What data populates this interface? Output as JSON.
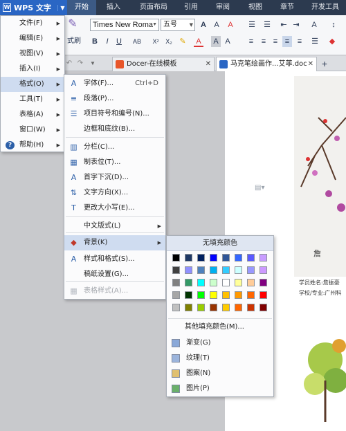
{
  "app": {
    "name": "WPS 文字"
  },
  "ribbon_tabs": [
    {
      "label": "开始",
      "active": true
    },
    {
      "label": "插入",
      "active": false
    },
    {
      "label": "页面布局",
      "active": false
    },
    {
      "label": "引用",
      "active": false
    },
    {
      "label": "审阅",
      "active": false
    },
    {
      "label": "视图",
      "active": false
    },
    {
      "label": "章节",
      "active": false
    },
    {
      "label": "开发工具",
      "active": false
    }
  ],
  "toolbar": {
    "font_name": "Times New Roma",
    "font_size": "五号",
    "format_painter": "式刷",
    "bold": "B",
    "italic": "I",
    "underline": "U",
    "ab": "AB",
    "sup": "X²",
    "sub": "X₂"
  },
  "doc_tabs": [
    {
      "label": "Docer-在线模板",
      "color": "#e8562a"
    },
    {
      "label": "马克笔绘画作...艾菲.doc",
      "color": "#2a66c4"
    }
  ],
  "main_menu": [
    {
      "label": "文件(F)",
      "icon": "none"
    },
    {
      "label": "编辑(E)",
      "icon": "none"
    },
    {
      "label": "视图(V)",
      "icon": "none"
    },
    {
      "label": "插入(I)",
      "icon": "none"
    },
    {
      "label": "格式(O)",
      "icon": "none",
      "highlighted": true
    },
    {
      "label": "工具(T)",
      "icon": "none"
    },
    {
      "label": "表格(A)",
      "icon": "none"
    },
    {
      "label": "窗口(W)",
      "icon": "none"
    },
    {
      "label": "帮助(H)",
      "icon": "help-icon"
    }
  ],
  "format_menu": [
    {
      "label": "字体(F)...",
      "shortcut": "Ctrl+D",
      "icon": "font-icon",
      "glyph": "A"
    },
    {
      "label": "段落(P)...",
      "icon": "paragraph-icon",
      "glyph": "≡"
    },
    {
      "label": "项目符号和编号(N)...",
      "icon": "bullet-list-icon",
      "glyph": "☰"
    },
    {
      "label": "边框和底纹(B)...",
      "icon": "none",
      "glyph": ""
    },
    {
      "label": "分栏(C)...",
      "icon": "columns-icon",
      "glyph": "▥"
    },
    {
      "label": "制表位(T)...",
      "icon": "tab-stop-icon",
      "glyph": "▦"
    },
    {
      "label": "首字下沉(D)...",
      "icon": "drop-cap-icon",
      "glyph": "A"
    },
    {
      "label": "文字方向(X)...",
      "icon": "text-direction-icon",
      "glyph": "⇅"
    },
    {
      "label": "更改大小写(E)...",
      "icon": "change-case-icon",
      "glyph": "T"
    },
    {
      "label": "中文版式(L)",
      "icon": "none",
      "glyph": "",
      "submenu": true
    },
    {
      "label": "背景(K)",
      "icon": "paint-bucket-icon",
      "glyph": "◆",
      "submenu": true,
      "highlighted": true
    },
    {
      "label": "样式和格式(S)...",
      "icon": "styles-icon",
      "glyph": "A"
    },
    {
      "label": "稿纸设置(G)...",
      "icon": "none",
      "glyph": ""
    },
    {
      "label": "表格样式(A)...",
      "icon": "table-style-icon",
      "glyph": "▦",
      "disabled": true
    }
  ],
  "color_menu": {
    "title": "无填充颜色",
    "swatches": [
      [
        "#000000",
        "#1f3864",
        "#002060",
        "#0000ff",
        "#2f5597",
        "#3366ff",
        "#5a5aff",
        "#c89cff"
      ],
      [
        "#404040",
        "#9090ff",
        "#4f81bd",
        "#00b0f0",
        "#33ccff",
        "#ccffff",
        "#9999ff",
        "#cc99ff"
      ],
      [
        "#808080",
        "#339966",
        "#00ffff",
        "#ccffcc",
        "#ffffff",
        "#ffff99",
        "#ffcc99",
        "#800080"
      ],
      [
        "#a6a6a6",
        "#003300",
        "#00ff00",
        "#ffff00",
        "#ffc000",
        "#ff9900",
        "#ff6600",
        "#ff0000"
      ],
      [
        "#c0c0c0",
        "#808000",
        "#99cc00",
        "#993300",
        "#ffcc00",
        "#ff6600",
        "#cc3300",
        "#800000"
      ]
    ],
    "more_colors": "其他填充颜色(M)...",
    "items": [
      {
        "label": "渐变(G)",
        "icon": "gradient-icon",
        "color": "#8aa8d8"
      },
      {
        "label": "纹理(T)",
        "icon": "texture-icon",
        "color": "#9bb4dc"
      },
      {
        "label": "图案(N)",
        "icon": "pattern-icon",
        "color": "#e0c070"
      },
      {
        "label": "图片(P)",
        "icon": "picture-icon",
        "color": "#6ab06a"
      }
    ]
  },
  "document": {
    "caption1": "学员姓名:詹振豪",
    "caption2": "学校/专业:广州科"
  }
}
